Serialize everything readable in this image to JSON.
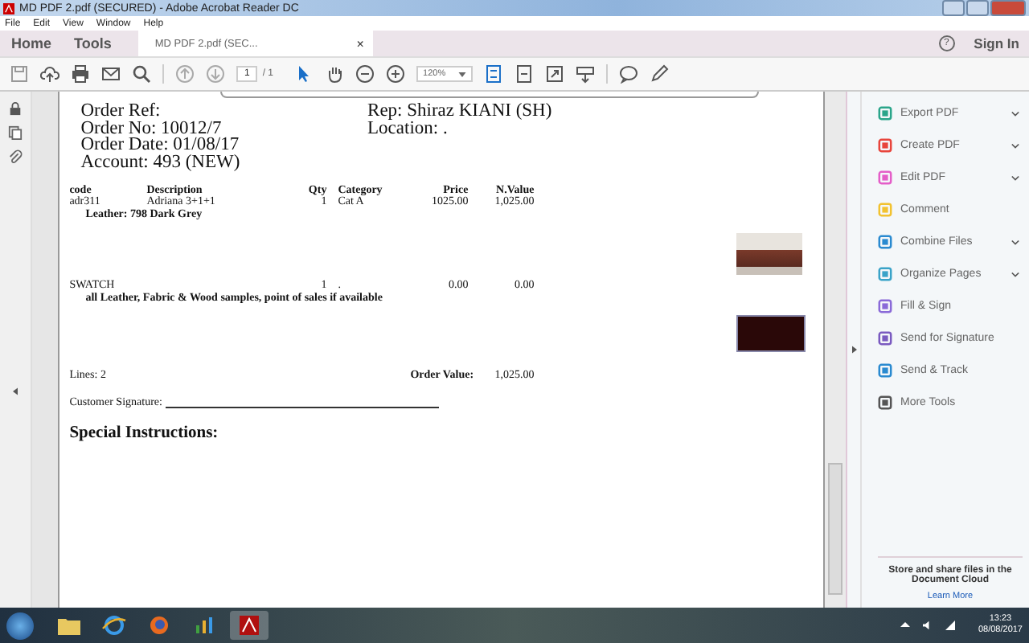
{
  "window": {
    "title": "MD PDF 2.pdf (SECURED) - Adobe Acrobat Reader DC"
  },
  "menu": [
    "File",
    "Edit",
    "View",
    "Window",
    "Help"
  ],
  "tabs": [
    {
      "label": "Home",
      "selected": false
    },
    {
      "label": "Tools",
      "selected": false
    },
    {
      "label": "MD PDF 2.pdf (SEC...",
      "selected": true
    }
  ],
  "tab_close": "×",
  "help": "?",
  "sign_in": "Sign In",
  "toolbar": {
    "page": "1",
    "page_total": "/ 1",
    "zoom": "120%"
  },
  "document": {
    "header_left": [
      "Order Ref:",
      "Order No: 10012/7",
      "Order Date: 01/08/17",
      "Account: 493 (NEW)"
    ],
    "header_right": [
      "Rep: Shiraz KIANI (SH)",
      "Location: ."
    ],
    "columns": [
      "code",
      "Description",
      "Qty",
      "Category",
      "Price",
      "N.Value"
    ],
    "rows": [
      {
        "cells": [
          "adr311",
          "Adriana 3+1+1",
          "1",
          "Cat A",
          "1025.00",
          "1,025.00"
        ],
        "note": "Leather: 798 Dark Grey"
      },
      {
        "cells": [
          "SWATCH",
          "",
          "1",
          ".",
          "0.00",
          "0.00"
        ],
        "note": "all Leather, Fabric & Wood samples, point of sales if available"
      }
    ],
    "lines": "Lines: 2",
    "order_value_label": "Order Value:",
    "order_value": "1,025.00",
    "signature_label": "Customer Signature:",
    "special_instructions": "Special Instructions:"
  },
  "tools": [
    {
      "label": "Export PDF",
      "expandable": true,
      "color": "#2aa58a"
    },
    {
      "label": "Create PDF",
      "expandable": true,
      "color": "#e8453c"
    },
    {
      "label": "Edit PDF",
      "expandable": true,
      "color": "#e45ec8"
    },
    {
      "label": "Comment",
      "expandable": false,
      "color": "#f2c230"
    },
    {
      "label": "Combine Files",
      "expandable": true,
      "color": "#2a8ad0"
    },
    {
      "label": "Organize Pages",
      "expandable": true,
      "color": "#3aa3c8"
    },
    {
      "label": "Fill & Sign",
      "expandable": false,
      "color": "#8a6ad8"
    },
    {
      "label": "Send for Signature",
      "expandable": false,
      "color": "#7a5ac0"
    },
    {
      "label": "Send & Track",
      "expandable": false,
      "color": "#2a8ad0"
    },
    {
      "label": "More Tools",
      "expandable": false,
      "color": "#555555"
    }
  ],
  "cloud": {
    "text": "Store and share files in the Document Cloud",
    "link": "Learn More"
  },
  "taskbar": {
    "time": "13:23",
    "date": "08/08/2017"
  }
}
